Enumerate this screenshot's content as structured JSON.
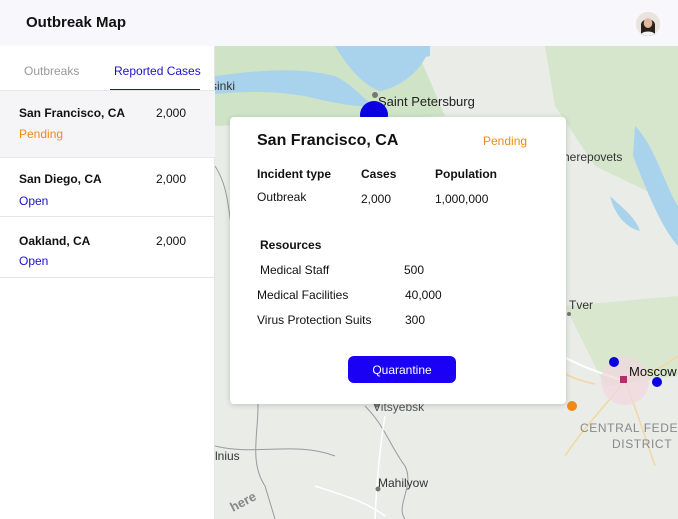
{
  "header": {
    "title": "Outbreak Map"
  },
  "sidebar": {
    "tabs": [
      {
        "label": "Outbreaks",
        "active": false
      },
      {
        "label": "Reported Cases",
        "active": true
      }
    ],
    "cases": [
      {
        "name": "San Francisco, CA",
        "count": "2,000",
        "status": "Pending"
      },
      {
        "name": "San Diego, CA",
        "count": "2,000",
        "status": "Open"
      },
      {
        "name": "Oakland, CA",
        "count": "2,000",
        "status": "Open"
      }
    ]
  },
  "map": {
    "labels": {
      "saint_petersburg": "Saint Petersburg",
      "cherepovets": "herepovets",
      "sinki": "sinki",
      "tver": "Tver",
      "moscow": "Moscow",
      "vitsyebsk": "Vitsyebsk",
      "central_1": "CENTRAL FEDE",
      "central_2": "DISTRICT",
      "vilnius": "lnius",
      "mahilyow": "Mahilyow",
      "watermark": "here"
    },
    "marker_colors": {
      "open": "#0a00e0",
      "pending": "#f08a17"
    }
  },
  "popup": {
    "title": "San Francisco, CA",
    "status": "Pending",
    "headers": {
      "incident_type": "Incident type",
      "cases": "Cases",
      "population": "Population"
    },
    "values": {
      "incident_type": "Outbreak",
      "cases": "2,000",
      "population": "1,000,000"
    },
    "resources_title": "Resources",
    "resources": [
      {
        "name": "Medical Staff",
        "value": "500"
      },
      {
        "name": "Medical Facilities",
        "value": "40,000"
      },
      {
        "name": "Virus Protection Suits",
        "value": "300"
      }
    ],
    "action_label": "Quarantine"
  }
}
